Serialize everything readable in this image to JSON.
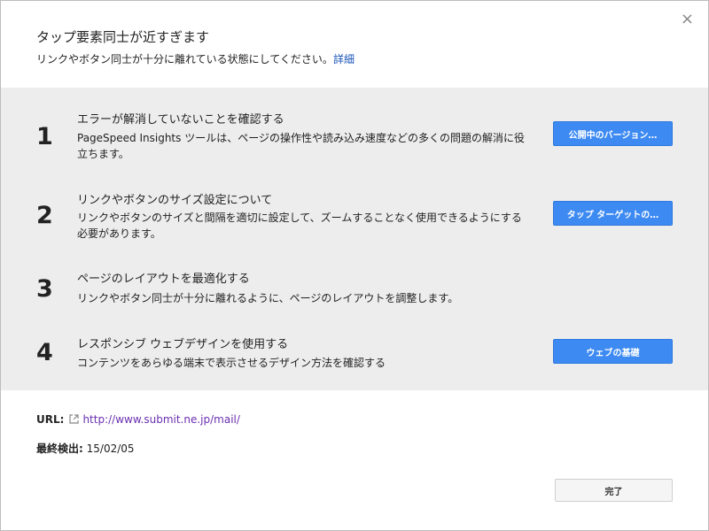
{
  "dialog": {
    "title": "タップ要素同士が近すぎます",
    "subtitle": "リンクやボタン同士が十分に離れている状態にしてください。",
    "details_link": "詳細",
    "close_glyph": "×"
  },
  "steps": [
    {
      "number": "1",
      "title": "エラーが解消していないことを確認する",
      "desc": "PageSpeed Insights ツールは、ページの操作性や読み込み速度などの多くの問題の解消に役立ちます。",
      "button": "公開中のバージョン…"
    },
    {
      "number": "2",
      "title": "リンクやボタンのサイズ設定について",
      "desc": "リンクやボタンのサイズと間隔を適切に設定して、ズームすることなく使用できるようにする必要があります。",
      "button": "タップ ターゲットの…"
    },
    {
      "number": "3",
      "title": "ページのレイアウトを最適化する",
      "desc": "リンクやボタン同士が十分に離れるように、ページのレイアウトを調整します。"
    },
    {
      "number": "4",
      "title": "レスポンシブ ウェブデザインを使用する",
      "desc": "コンテンツをあらゆる端末で表示させるデザイン方法を確認する",
      "button": "ウェブの基礎"
    }
  ],
  "meta": {
    "url_label": "URL:",
    "url": "http://www.submit.ne.jp/mail/",
    "detected_label": "最終検出:",
    "detected_value": "15/02/05"
  },
  "footer": {
    "done_label": "完了"
  },
  "colors": {
    "primary_button": "#3d8af2",
    "link": "#1a54b8",
    "url": "#6a2fb0",
    "steps_bg": "#ededed"
  },
  "icons": {
    "close": "close-icon",
    "external_link": "external-link-icon"
  }
}
